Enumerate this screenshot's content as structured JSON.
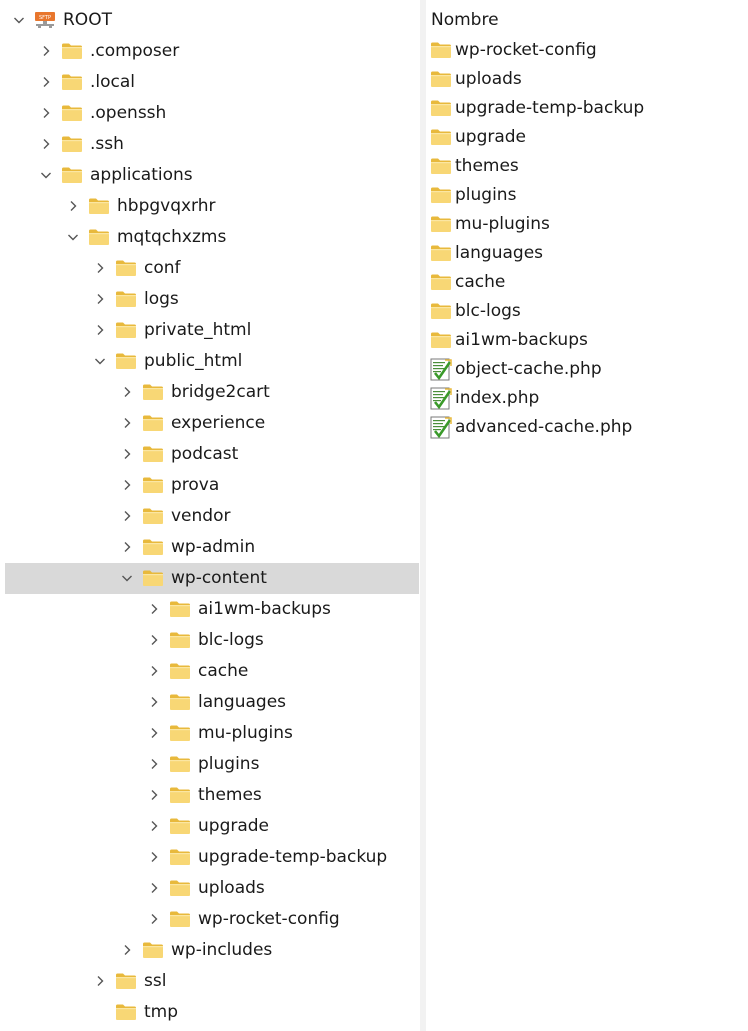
{
  "tree": {
    "items": [
      {
        "label": "ROOT",
        "depth": 0,
        "expanded": true,
        "icon": "sftp-root-icon"
      },
      {
        "label": ".composer",
        "depth": 1,
        "expanded": false
      },
      {
        "label": ".local",
        "depth": 1,
        "expanded": false
      },
      {
        "label": ".openssh",
        "depth": 1,
        "expanded": false
      },
      {
        "label": ".ssh",
        "depth": 1,
        "expanded": false
      },
      {
        "label": "applications",
        "depth": 1,
        "expanded": true
      },
      {
        "label": "hbpgvqxrhr",
        "depth": 2,
        "expanded": false
      },
      {
        "label": "mqtqchxzms",
        "depth": 2,
        "expanded": true
      },
      {
        "label": "conf",
        "depth": 3,
        "expanded": false
      },
      {
        "label": "logs",
        "depth": 3,
        "expanded": false
      },
      {
        "label": "private_html",
        "depth": 3,
        "expanded": false
      },
      {
        "label": "public_html",
        "depth": 3,
        "expanded": true
      },
      {
        "label": "bridge2cart",
        "depth": 4,
        "expanded": false
      },
      {
        "label": "experience",
        "depth": 4,
        "expanded": false
      },
      {
        "label": "podcast",
        "depth": 4,
        "expanded": false
      },
      {
        "label": "prova",
        "depth": 4,
        "expanded": false
      },
      {
        "label": "vendor",
        "depth": 4,
        "expanded": false
      },
      {
        "label": "wp-admin",
        "depth": 4,
        "expanded": false
      },
      {
        "label": "wp-content",
        "depth": 4,
        "expanded": true,
        "selected": true
      },
      {
        "label": "ai1wm-backups",
        "depth": 5,
        "expanded": false
      },
      {
        "label": "blc-logs",
        "depth": 5,
        "expanded": false
      },
      {
        "label": "cache",
        "depth": 5,
        "expanded": false
      },
      {
        "label": "languages",
        "depth": 5,
        "expanded": false
      },
      {
        "label": "mu-plugins",
        "depth": 5,
        "expanded": false
      },
      {
        "label": "plugins",
        "depth": 5,
        "expanded": false
      },
      {
        "label": "themes",
        "depth": 5,
        "expanded": false
      },
      {
        "label": "upgrade",
        "depth": 5,
        "expanded": false
      },
      {
        "label": "upgrade-temp-backup",
        "depth": 5,
        "expanded": false
      },
      {
        "label": "uploads",
        "depth": 5,
        "expanded": false
      },
      {
        "label": "wp-rocket-config",
        "depth": 5,
        "expanded": false
      },
      {
        "label": "wp-includes",
        "depth": 4,
        "expanded": false
      },
      {
        "label": "ssl",
        "depth": 3,
        "expanded": false
      },
      {
        "label": "tmp",
        "depth": 3,
        "expanded": null
      }
    ]
  },
  "list": {
    "header": "Nombre",
    "items": [
      {
        "name": "wp-rocket-config",
        "type": "folder"
      },
      {
        "name": "uploads",
        "type": "folder"
      },
      {
        "name": "upgrade-temp-backup",
        "type": "folder"
      },
      {
        "name": "upgrade",
        "type": "folder"
      },
      {
        "name": "themes",
        "type": "folder"
      },
      {
        "name": "plugins",
        "type": "folder"
      },
      {
        "name": "mu-plugins",
        "type": "folder"
      },
      {
        "name": "languages",
        "type": "folder"
      },
      {
        "name": "cache",
        "type": "folder"
      },
      {
        "name": "blc-logs",
        "type": "folder"
      },
      {
        "name": "ai1wm-backups",
        "type": "folder"
      },
      {
        "name": "object-cache.php",
        "type": "php"
      },
      {
        "name": "index.php",
        "type": "php"
      },
      {
        "name": "advanced-cache.php",
        "type": "php"
      }
    ]
  },
  "colors": {
    "folder": "#f8d775",
    "folder_dark": "#e8b93c",
    "selection": "#d9d9d9",
    "sftp": "#e8762d"
  }
}
